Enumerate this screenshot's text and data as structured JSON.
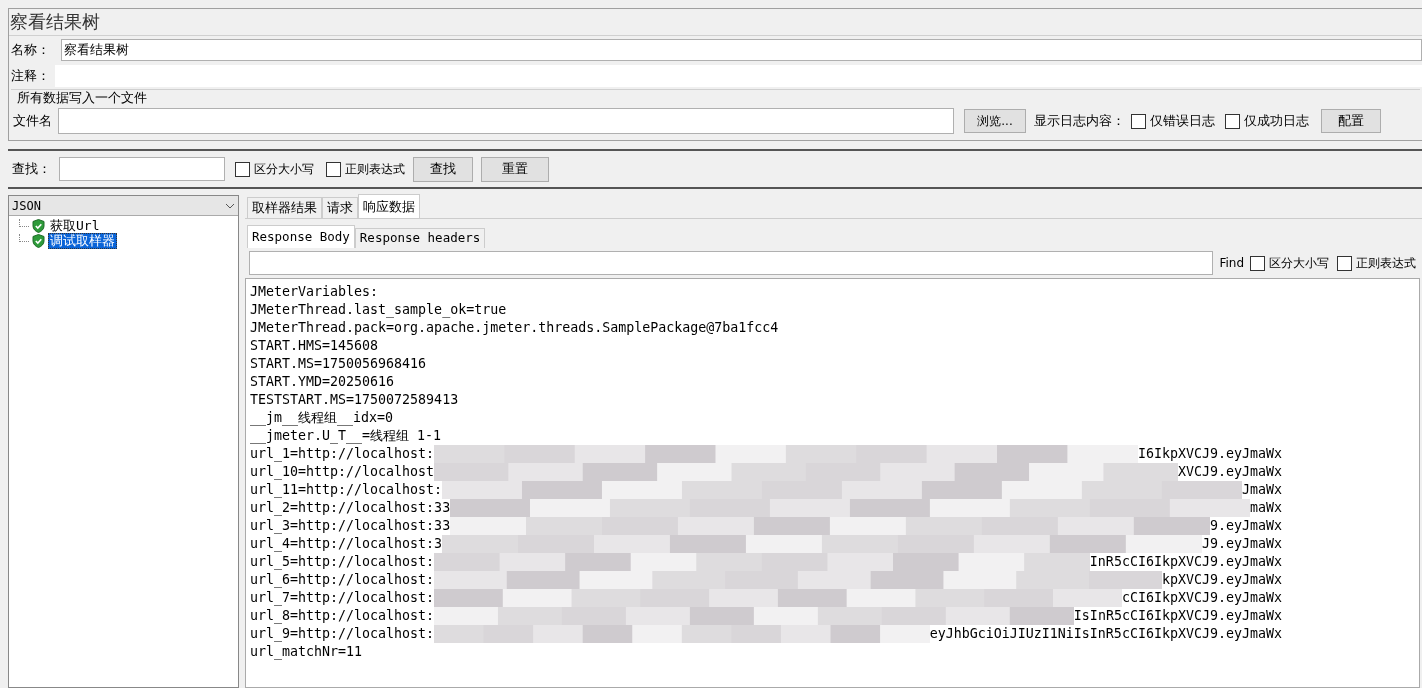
{
  "title": "察看结果树",
  "name_field": {
    "label": "名称：",
    "value": "察看结果树"
  },
  "comment_field": {
    "label": "注释："
  },
  "file_group": {
    "legend": "所有数据写入一个文件",
    "file_label": "文件名",
    "browse_button": "浏览...",
    "log_label": "显示日志内容：",
    "checkboxes": [
      {
        "label": "仅错误日志",
        "checked": false
      },
      {
        "label": "仅成功日志",
        "checked": false
      }
    ],
    "config_button": "配置"
  },
  "search": {
    "label": "查找：",
    "checkboxes": [
      {
        "label": "区分大小写",
        "checked": false
      },
      {
        "label": "正则表达式",
        "checked": false
      }
    ],
    "find_button": "查找",
    "reset_button": "重置"
  },
  "renderer": {
    "value": "JSON"
  },
  "tree": [
    {
      "label": "获取Url",
      "selected": false
    },
    {
      "label": "调试取样器",
      "selected": true
    }
  ],
  "tabs": [
    {
      "label": "取样器结果",
      "selected": false
    },
    {
      "label": "请求",
      "selected": false
    },
    {
      "label": "响应数据",
      "selected": true
    }
  ],
  "sub_tabs": [
    {
      "label": "Response Body",
      "selected": true
    },
    {
      "label": "Response headers",
      "selected": false
    }
  ],
  "find_bar": {
    "label": "Find",
    "checkboxes": [
      {
        "label": "区分大小写",
        "checked": false
      },
      {
        "label": "正则表达式",
        "checked": false
      }
    ]
  },
  "response_lines": [
    {
      "kind": "text",
      "text": "JMeterVariables:"
    },
    {
      "kind": "text",
      "text": "JMeterThread.last_sample_ok=true"
    },
    {
      "kind": "text",
      "text": "JMeterThread.pack=org.apache.jmeter.threads.SamplePackage@7ba1fcc4"
    },
    {
      "kind": "text",
      "text": "START.HMS=145608"
    },
    {
      "kind": "text",
      "text": "START.MS=1750056968416"
    },
    {
      "kind": "text",
      "text": "START.YMD=20250616"
    },
    {
      "kind": "text",
      "text": "TESTSTART.MS=1750072589413"
    },
    {
      "kind": "text",
      "text": "__jm__线程组__idx=0"
    },
    {
      "kind": "text",
      "text": "__jmeter.U_T__=线程组 1-1"
    },
    {
      "kind": "redacted",
      "start": "url_1=http://localhost:",
      "end": "I6IkpXVCJ9.eyJmaWx"
    },
    {
      "kind": "redacted",
      "start": "url_10=http://localhost",
      "end": "XVCJ9.eyJmaWx"
    },
    {
      "kind": "redacted",
      "start": "url_11=http://localhost:",
      "end": "JmaWx"
    },
    {
      "kind": "redacted",
      "start": "url_2=http://localhost:33",
      "end": "maWx"
    },
    {
      "kind": "redacted",
      "start": "url_3=http://localhost:33",
      "end": "9.eyJmaWx"
    },
    {
      "kind": "redacted",
      "start": "url_4=http://localhost:3",
      "end": "J9.eyJmaWx"
    },
    {
      "kind": "redacted",
      "start": "url_5=http://localhost:",
      "end": "InR5cCI6IkpXVCJ9.eyJmaWx"
    },
    {
      "kind": "redacted",
      "start": "url_6=http://localhost:",
      "end": "kpXVCJ9.eyJmaWx"
    },
    {
      "kind": "redacted",
      "start": "url_7=http://localhost:",
      "end": "cCI6IkpXVCJ9.eyJmaWx"
    },
    {
      "kind": "redacted",
      "start": "url_8=http://localhost:",
      "end": "IsInR5cCI6IkpXVCJ9.eyJmaWx"
    },
    {
      "kind": "redacted",
      "start": "url_9=http://localhost:",
      "end": "eyJhbGciOiJIUzI1NiIsInR5cCI6IkpXVCJ9.eyJmaWx"
    },
    {
      "kind": "text",
      "text": "url_matchNr=11"
    }
  ]
}
